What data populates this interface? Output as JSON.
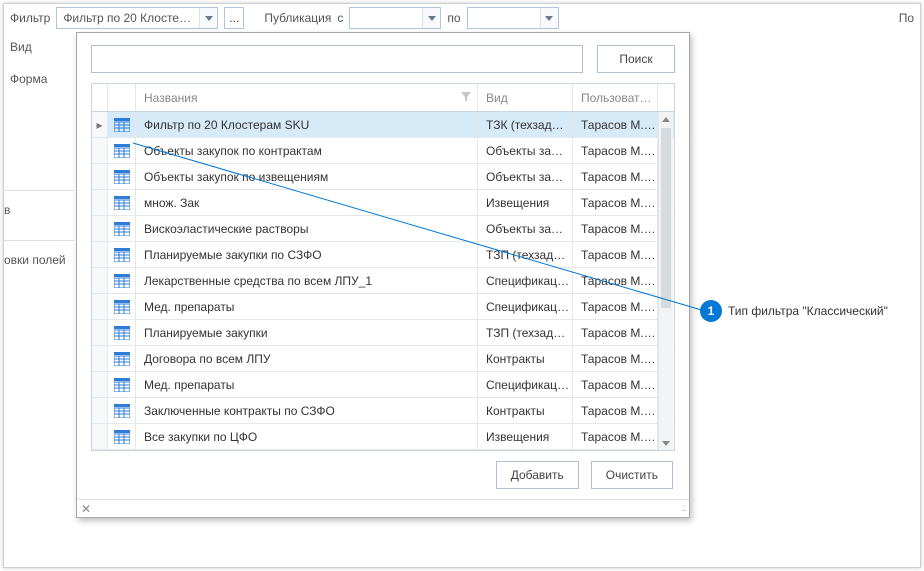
{
  "toolbar": {
    "filter_label": "Фильтр",
    "filter_value": "Фильтр по 20 Клосте…",
    "ellipsis": "...",
    "publication_label": "Публикация",
    "from_label": "с",
    "to_label": "по",
    "po_truncated": "По"
  },
  "sidebar": {
    "vid": "Вид",
    "form": "Форма",
    "bg1": "в",
    "bg2": "овки полей"
  },
  "popup": {
    "search_placeholder": "",
    "search_btn": "Поиск",
    "add_btn": "Добавить",
    "clear_btn": "Очистить",
    "close_glyph": "✕"
  },
  "grid": {
    "headers": {
      "name": "Названия",
      "vid": "Вид",
      "user": "Пользоват…"
    },
    "rows": [
      {
        "name": "Фильтр по 20 Клостерам SKU",
        "vid": "ТЗК (техзад…",
        "user": "Тарасов М.…",
        "selected": true
      },
      {
        "name": "Объекты закупок по контрактам",
        "vid": "Объекты за…",
        "user": "Тарасов М.…"
      },
      {
        "name": "Объекты закупок по извещениям",
        "vid": "Объекты за…",
        "user": "Тарасов М.…"
      },
      {
        "name": "множ. Зак",
        "vid": "Извещения",
        "user": "Тарасов М.…"
      },
      {
        "name": "Вискоэластические растворы",
        "vid": "Объекты за…",
        "user": "Тарасов М.…"
      },
      {
        "name": "Планируемые закупки по СЗФО",
        "vid": "ТЗП (техзад…",
        "user": "Тарасов М.…"
      },
      {
        "name": "Лекарственные средства по всем ЛПУ_1",
        "vid": "Спецификац…",
        "user": "Тарасов М.…"
      },
      {
        "name": "Мед. препараты",
        "vid": "Спецификац…",
        "user": "Тарасов М.…"
      },
      {
        "name": "Планируемые закупки",
        "vid": "ТЗП (техзад…",
        "user": "Тарасов М.…"
      },
      {
        "name": "Договора по всем ЛПУ",
        "vid": "Контракты",
        "user": "Тарасов М.…"
      },
      {
        "name": "Мед. препараты",
        "vid": "Спецификац…",
        "user": "Тарасов М.…"
      },
      {
        "name": "Заключенные контракты по СЗФО",
        "vid": "Контракты",
        "user": "Тарасов М.…"
      },
      {
        "name": "Все закупки по ЦФО",
        "vid": "Извещения",
        "user": "Тарасов М.…"
      }
    ]
  },
  "callout": {
    "number": "1",
    "text": "Тип фильтра \"Классический\""
  }
}
